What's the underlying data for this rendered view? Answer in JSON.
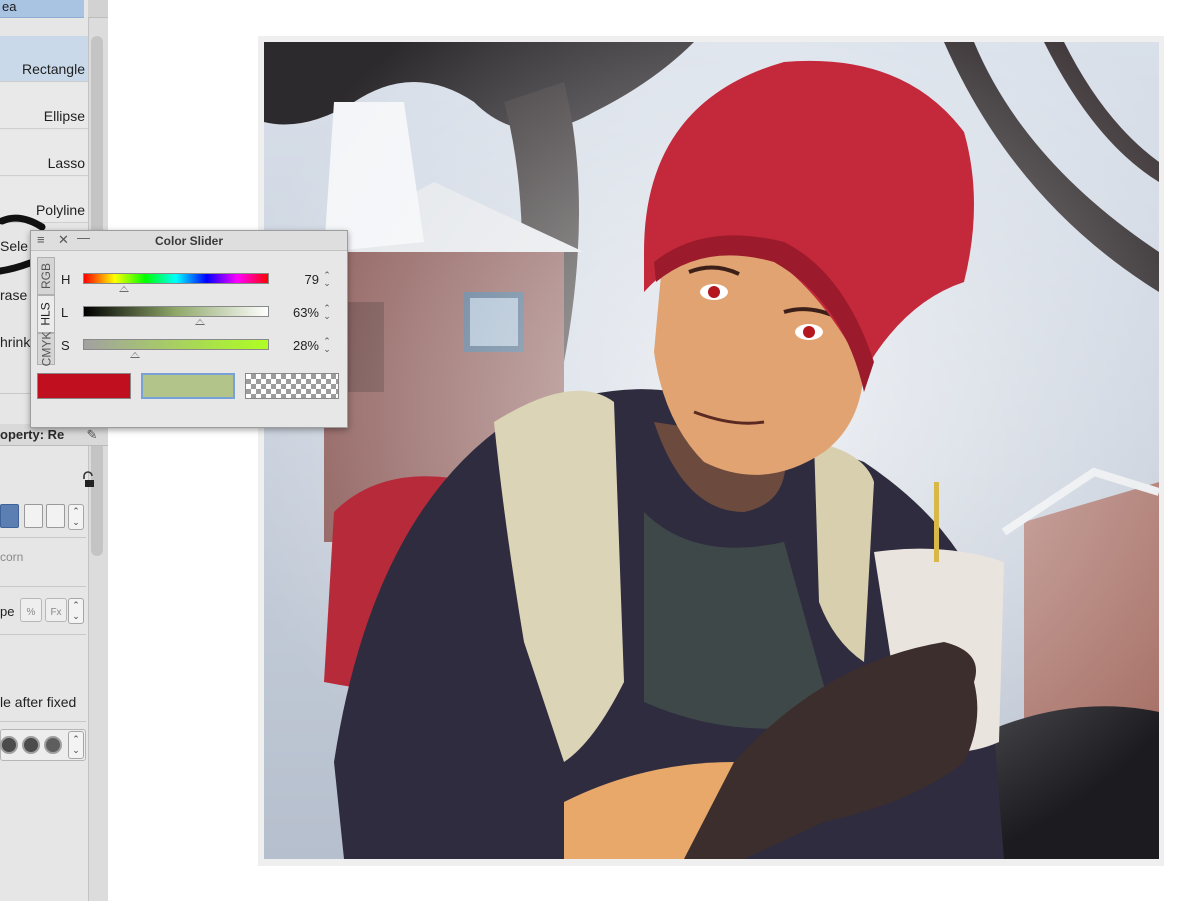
{
  "tool_panel": {
    "top_tab_label": "ea",
    "selection_tools": [
      {
        "label": "Rectangle",
        "active": true
      },
      {
        "label": "Ellipse",
        "active": false
      },
      {
        "label": "Lasso",
        "active": false
      },
      {
        "label": "Polyline",
        "active": false
      }
    ],
    "partial_tools": [
      "Sele",
      "rase",
      "hrink"
    ],
    "property_header": "operty: Re",
    "corner_label": "corn",
    "type_label": "pe",
    "fx_buttons": [
      "%",
      "Fx"
    ],
    "after_fixed_label": "le after fixed"
  },
  "color_slider": {
    "title": "Color Slider",
    "tabs": [
      "RGB",
      "HLS",
      "CMYK"
    ],
    "active_tab": "HLS",
    "sliders": [
      {
        "label": "H",
        "value": "79",
        "fraction": 0.22
      },
      {
        "label": "L",
        "value": "63%",
        "fraction": 0.63
      },
      {
        "label": "S",
        "value": "28%",
        "fraction": 0.28
      }
    ],
    "main_color": "#c0101f",
    "sub_color": "#b2c48a"
  },
  "colors": {
    "panel_bg": "#e6e6e6",
    "active_tool_bg": "#c9d9ea",
    "accent_blue": "#5b7fb3"
  }
}
